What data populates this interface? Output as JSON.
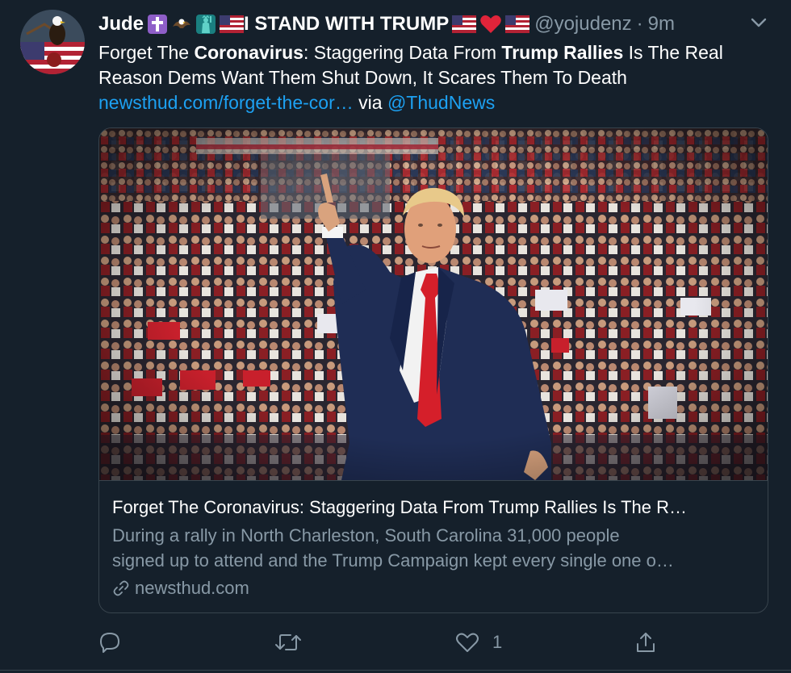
{
  "tweet": {
    "author_name": "Jude",
    "emoji_sequence": [
      "latin-cross-emoji",
      "eagle-emoji",
      "statue-of-liberty-emoji",
      "us-flag-emoji"
    ],
    "display_suffix": "I STAND WITH TRUMP",
    "suffix_emojis": [
      "us-flag-emoji",
      "red-heart-emoji",
      "us-flag-emoji"
    ],
    "handle": "@yojudenz",
    "separator": "·",
    "time": "9m",
    "text": {
      "p1": "Forget The ",
      "b1": "Coronavirus",
      "p2": ": Staggering Data From ",
      "b2": "Trump Rallies",
      "p3": " Is The Real Reason Dems Want Them Shut Down, It Scares Them To Death",
      "link": "newsthud.com/forget-the-cor…",
      "via": " via ",
      "mention": "@ThudNews"
    }
  },
  "card": {
    "title": "Forget The Coronavirus: Staggering Data From Trump Rallies Is The R…",
    "desc_line1": "During a rally in North Charleston, South Carolina 31,000 people",
    "desc_line2": "signed up to attend and the Trump Campaign kept every single one o…",
    "domain": "newsthud.com",
    "image_desc_icon": "rally-photo"
  },
  "actions": {
    "reply_count": "",
    "retweet_count": "",
    "like_count": "1",
    "share_count": ""
  },
  "colors": {
    "background": "#15202b",
    "link": "#1da1f2",
    "muted": "#8899a6",
    "border": "#38444d"
  }
}
